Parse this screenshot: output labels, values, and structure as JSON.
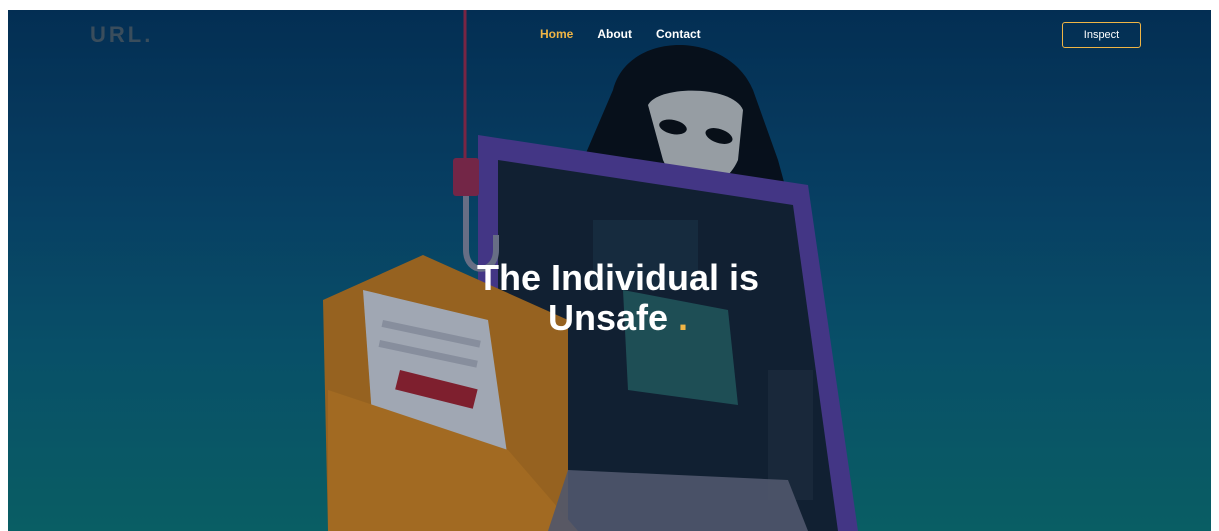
{
  "brand": {
    "logo": "URL."
  },
  "nav": {
    "items": [
      {
        "label": "Home",
        "active": true
      },
      {
        "label": "About",
        "active": false
      },
      {
        "label": "Contact",
        "active": false
      }
    ],
    "inspect_label": "Inspect"
  },
  "hero": {
    "line1": "The Individual is",
    "line2": "Unsafe",
    "accent": "."
  },
  "colors": {
    "accent": "#f0b545",
    "background_top": "#05355e",
    "background_bottom": "#0d7474"
  },
  "illustration": {
    "subject": "hacker-phishing-illustration"
  }
}
